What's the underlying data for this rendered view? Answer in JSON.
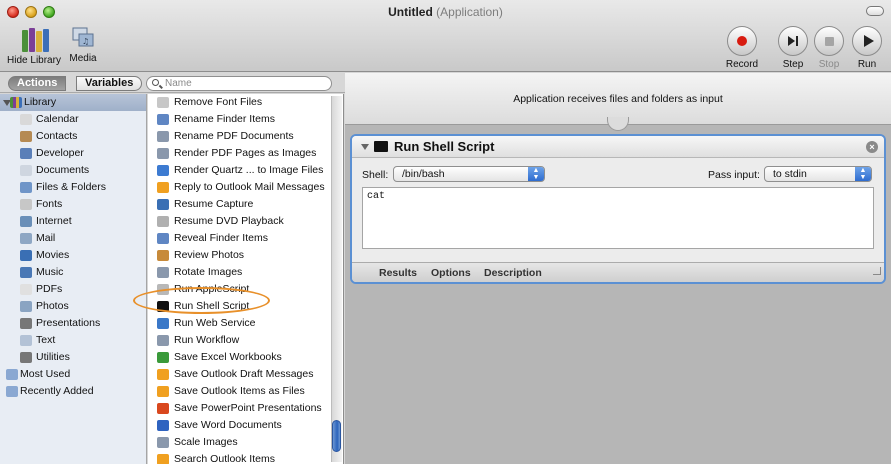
{
  "window": {
    "title": "Untitled",
    "subtitle": "(Application)"
  },
  "toolbar": {
    "hide_library_label": "Hide Library",
    "media_label": "Media",
    "record_label": "Record",
    "step_label": "Step",
    "stop_label": "Stop",
    "run_label": "Run"
  },
  "library_header": {
    "actions_tab": "Actions",
    "variables_tab": "Variables",
    "search_placeholder": "Name"
  },
  "library": {
    "root": "Library",
    "items": [
      {
        "label": "Calendar",
        "icon": "calendar-icon",
        "color": "#d9d9d9"
      },
      {
        "label": "Contacts",
        "icon": "contacts-icon",
        "color": "#b58a53"
      },
      {
        "label": "Developer",
        "icon": "developer-icon",
        "color": "#5a7fb8"
      },
      {
        "label": "Documents",
        "icon": "documents-icon",
        "color": "#cfd6e0"
      },
      {
        "label": "Files & Folders",
        "icon": "files-folders-icon",
        "color": "#6f95c8"
      },
      {
        "label": "Fonts",
        "icon": "fonts-icon",
        "color": "#c7c7c7"
      },
      {
        "label": "Internet",
        "icon": "internet-icon",
        "color": "#6a8fb8"
      },
      {
        "label": "Mail",
        "icon": "mail-icon",
        "color": "#8ea7c4"
      },
      {
        "label": "Movies",
        "icon": "movies-icon",
        "color": "#3a6fb4"
      },
      {
        "label": "Music",
        "icon": "music-icon",
        "color": "#4a78b5"
      },
      {
        "label": "PDFs",
        "icon": "pdfs-icon",
        "color": "#e0e0e0"
      },
      {
        "label": "Photos",
        "icon": "photos-icon",
        "color": "#8aa4c2"
      },
      {
        "label": "Presentations",
        "icon": "presentations-icon",
        "color": "#777777"
      },
      {
        "label": "Text",
        "icon": "text-icon",
        "color": "#b3c2d6"
      },
      {
        "label": "Utilities",
        "icon": "utilities-icon",
        "color": "#777777"
      }
    ],
    "extra": [
      {
        "label": "Most Used",
        "icon": "smart-folder-icon",
        "color": "#8aa8d2"
      },
      {
        "label": "Recently Added",
        "icon": "smart-folder-icon",
        "color": "#8aa8d2"
      }
    ]
  },
  "actions": [
    {
      "label": "Remove Font Files",
      "icon": "fonts-icon",
      "color": "#c7c7c7"
    },
    {
      "label": "Rename Finder Items",
      "icon": "finder-icon",
      "color": "#5f86c3"
    },
    {
      "label": "Rename PDF Documents",
      "icon": "automator-icon",
      "color": "#8a98ac"
    },
    {
      "label": "Render PDF Pages as Images",
      "icon": "automator-icon",
      "color": "#8a98ac"
    },
    {
      "label": "Render Quartz ... to Image Files",
      "icon": "quartz-icon",
      "color": "#3d7bd1"
    },
    {
      "label": "Reply to Outlook Mail Messages",
      "icon": "outlook-icon",
      "color": "#f0a020"
    },
    {
      "label": "Resume Capture",
      "icon": "capture-icon",
      "color": "#3a6fb4"
    },
    {
      "label": "Resume DVD Playback",
      "icon": "dvd-icon",
      "color": "#b0b0b0"
    },
    {
      "label": "Reveal Finder Items",
      "icon": "finder-icon",
      "color": "#5f86c3"
    },
    {
      "label": "Review Photos",
      "icon": "photos-icon",
      "color": "#c78a3a"
    },
    {
      "label": "Rotate Images",
      "icon": "automator-icon",
      "color": "#8a98ac"
    },
    {
      "label": "Run AppleScript",
      "icon": "applescript-icon",
      "color": "#b8b8b8"
    },
    {
      "label": "Run Shell Script",
      "icon": "terminal-icon",
      "color": "#111111"
    },
    {
      "label": "Run Web Service",
      "icon": "globe-icon",
      "color": "#3a78c8"
    },
    {
      "label": "Run Workflow",
      "icon": "workflow-icon",
      "color": "#8a98ac"
    },
    {
      "label": "Save Excel Workbooks",
      "icon": "excel-icon",
      "color": "#3a9a3a"
    },
    {
      "label": "Save Outlook Draft Messages",
      "icon": "outlook-icon",
      "color": "#f0a020"
    },
    {
      "label": "Save Outlook Items as Files",
      "icon": "outlook-icon",
      "color": "#f0a020"
    },
    {
      "label": "Save PowerPoint Presentations",
      "icon": "powerpoint-icon",
      "color": "#d9481e"
    },
    {
      "label": "Save Word Documents",
      "icon": "word-icon",
      "color": "#2f63c0"
    },
    {
      "label": "Scale Images",
      "icon": "automator-icon",
      "color": "#8a98ac"
    },
    {
      "label": "Search Outlook Items",
      "icon": "outlook-icon",
      "color": "#f0a020"
    }
  ],
  "workflow": {
    "header_text": "Application receives files and folders as input",
    "action": {
      "title": "Run Shell Script",
      "shell_label": "Shell:",
      "shell_value": "/bin/bash",
      "pass_input_label": "Pass input:",
      "pass_input_value": "to stdin",
      "script_text": "cat",
      "tabs": [
        "Results",
        "Options",
        "Description"
      ]
    }
  }
}
